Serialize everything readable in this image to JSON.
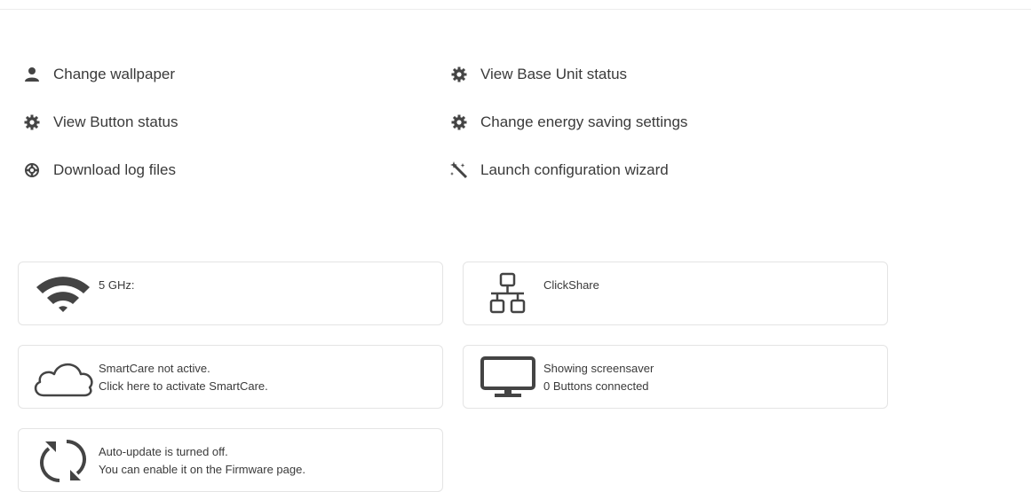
{
  "actions": {
    "change_wallpaper": "Change wallpaper",
    "view_button_status": "View Button status",
    "download_log_files": "Download log files",
    "view_base_unit_status": "View Base Unit status",
    "change_energy_saving": "Change energy saving settings",
    "launch_wizard": "Launch configuration wizard"
  },
  "cards": {
    "wifi": {
      "line1": "5 GHz:",
      "icon": "wifi-icon"
    },
    "network": {
      "line1": "ClickShare",
      "icon": "network-icon"
    },
    "smartcare": {
      "line1": "SmartCare not active.",
      "line2": "Click here to activate SmartCare.",
      "icon": "cloud-icon"
    },
    "screen": {
      "line1": "Showing screensaver",
      "line2": "0 Buttons connected",
      "icon": "monitor-icon"
    },
    "update": {
      "line1": "Auto-update is turned off.",
      "line2": "You can enable it on the Firmware page.",
      "icon": "refresh-icon"
    }
  },
  "colors": {
    "icon": "#444444",
    "card_border": "#e4e4e4",
    "text": "#3a3a3a"
  }
}
